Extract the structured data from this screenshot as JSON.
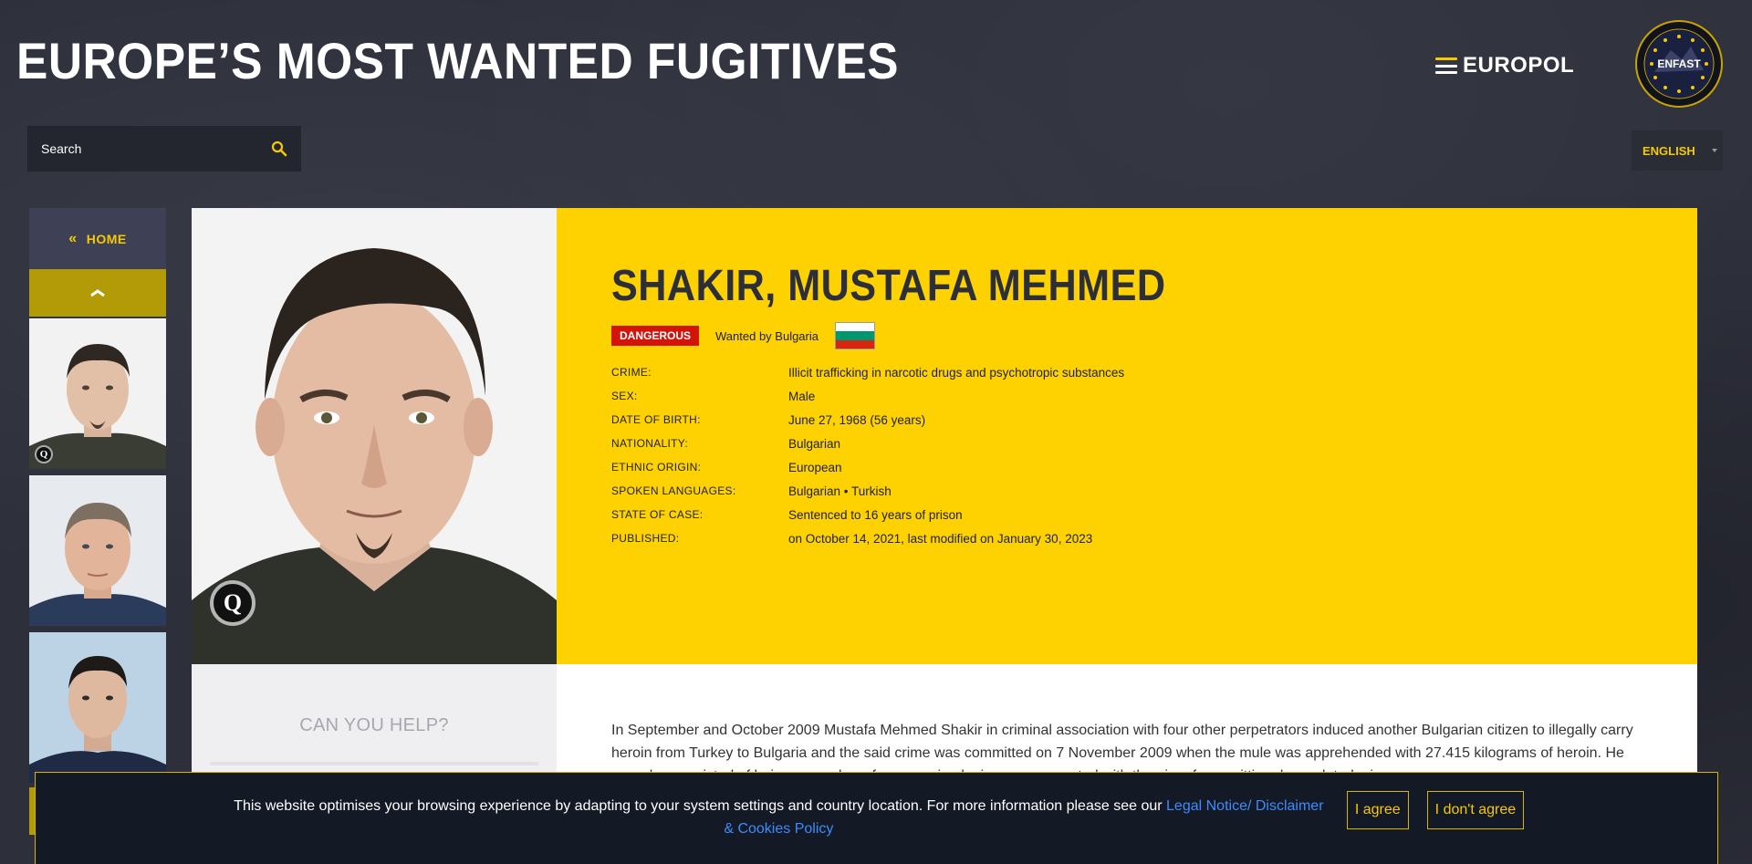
{
  "header": {
    "title": "EUROPE’S MOST WANTED FUGITIVES",
    "europol_logo_text": "EUROPOL",
    "enfast_logo_text": "ENFAST",
    "search_placeholder": "Search",
    "language": "ENGLISH"
  },
  "sidebar": {
    "home_label": "HOME"
  },
  "profile": {
    "name": "SHAKIR, MUSTAFA MEHMED",
    "badge": "DANGEROUS",
    "wanted_by": "Wanted by Bulgaria",
    "flag_colors": [
      "#ffffff",
      "#00966e",
      "#d62612"
    ],
    "facts": [
      {
        "label": "CRIME:",
        "value": "Illicit trafficking in narcotic drugs and psychotropic substances"
      },
      {
        "label": "SEX:",
        "value": "Male"
      },
      {
        "label": "DATE OF BIRTH:",
        "value": "June 27, 1968 (56 years)"
      },
      {
        "label": "NATIONALITY:",
        "value": "Bulgarian"
      },
      {
        "label": "ETHNIC ORIGIN:",
        "value": "European"
      },
      {
        "label": "SPOKEN LANGUAGES:",
        "value": "Bulgarian • Turkish"
      },
      {
        "label": "STATE OF CASE:",
        "value": "Sentenced to 16 years of prison"
      },
      {
        "label": "PUBLISHED:",
        "value": "on October 14, 2021, last modified on January 30, 2023"
      }
    ]
  },
  "help": {
    "title": "CAN YOU HELP?"
  },
  "description": "In September and October 2009 Mustafa Mehmed Shakir in criminal association with four other perpetrators induced another Bulgarian citizen to illegally carry heroin from Turkey to Bulgaria and the said crime was committed on 7 November 2009 when the mule was apprehended with 27.415 kilograms of heroin. He was also convicted of being a member of an organised crime group created with the aim of committing drug-related crimes.",
  "cookie": {
    "text": "This website optimises your browsing experience by adapting to your system settings and country location. For more information please see our ",
    "link": "Legal Notice/ Disclaimer & Cookies Policy",
    "agree": "I agree",
    "disagree": "I don't agree"
  },
  "colors": {
    "accent": "#fed200",
    "danger": "#d2140b",
    "link": "#3d8bfd"
  }
}
